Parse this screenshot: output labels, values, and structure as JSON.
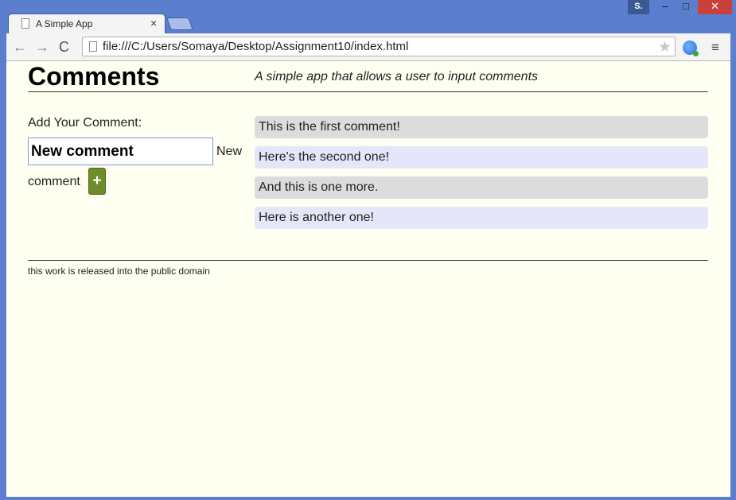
{
  "window": {
    "tab_title": "A Simple App",
    "tab_close": "×",
    "user_badge": "S.",
    "minimize": "–",
    "maximize": "□",
    "close": "✕"
  },
  "toolbar": {
    "url": "file:///C:/Users/Somaya/Desktop/Assignment10/index.html",
    "back": "←",
    "forward": "→",
    "reload": "C",
    "star": "★",
    "menu": "≡"
  },
  "page": {
    "title": "Comments",
    "tagline": "A simple app that allows a user to input comments",
    "form_label": "Add Your Comment:",
    "input_value": "New comment",
    "input_after_1": "New",
    "input_after_2": "comment",
    "add_label": "+",
    "comments": [
      "This is the first comment!",
      "Here's the second one!",
      "And this is one more.",
      "Here is another one!"
    ],
    "footer": "this work is released into the public domain"
  },
  "colors": {
    "chrome_frame": "#5b7fce",
    "page_background": "#fefff0",
    "comment_gray": "#dcdcdc",
    "comment_lavender": "#e5e6f9",
    "add_button": "#6e8c2a"
  }
}
